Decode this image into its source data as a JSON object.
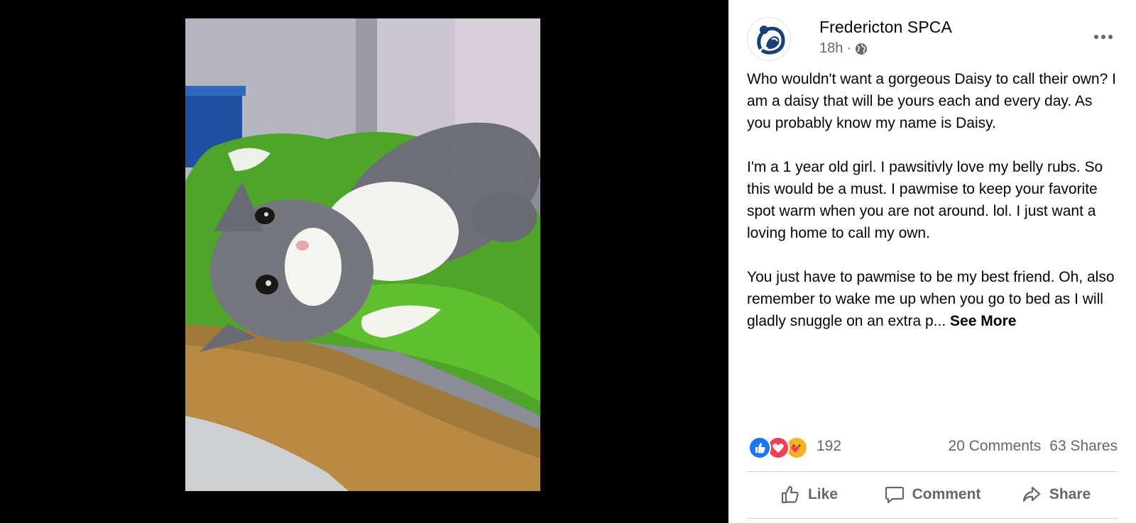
{
  "post": {
    "page_name": "Fredericton SPCA",
    "time": "18h",
    "separator": "·",
    "privacy_icon": "globe-icon",
    "paragraphs": [
      "Who wouldn't want a gorgeous Daisy to call their own? I am a daisy that will be yours each and every day. As you probably know my name is Daisy.",
      "I'm a 1 year old girl. I pawsitivly love my belly rubs. So this would be a must. I pawmise to keep your favorite spot warm when you are not around. lol. I just want a loving home to call my own.",
      "You just have to pawmise to be my best friend. Oh, also remember to wake me up when you go to bed as I will gladly snuggle on an extra p..."
    ],
    "see_more": "See More"
  },
  "reactions": {
    "icons": [
      "like-icon",
      "love-icon",
      "care-icon"
    ],
    "count": "192",
    "comments": "20 Comments",
    "shares": "63 Shares"
  },
  "actions": {
    "like": "Like",
    "comment": "Comment",
    "share": "Share"
  },
  "colors": {
    "like_blue": "#1877f2",
    "love_red": "#f33e58",
    "care_yellow": "#f7b125",
    "secondary_text": "#65676b",
    "spca_blue": "#1b3f7a"
  }
}
